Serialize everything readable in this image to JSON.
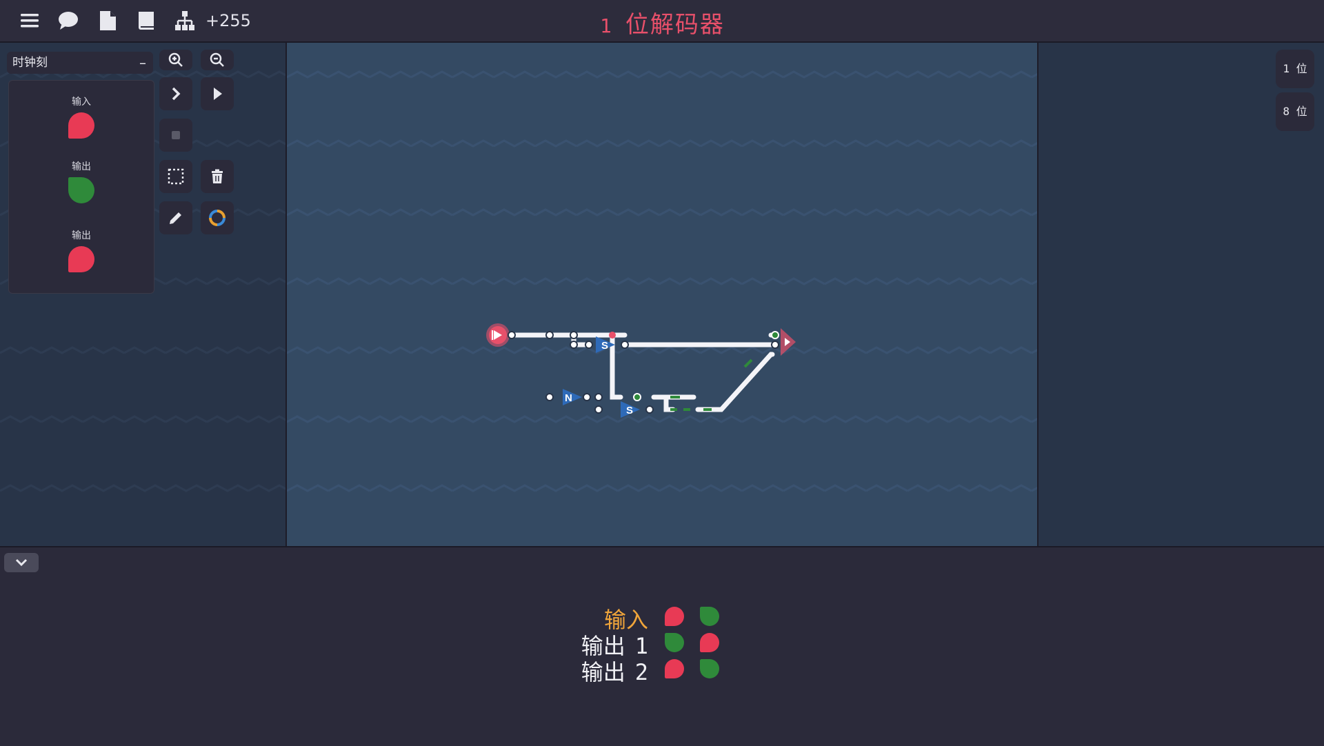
{
  "topbar": {
    "counter": "+255",
    "title_num": "1",
    "title_text": "位解码器",
    "title_color": "#e8506a",
    "icons": [
      "menu-icon",
      "chat-icon",
      "file-icon",
      "book-icon",
      "hierarchy-icon"
    ]
  },
  "sidebar": {
    "dropdown_value": "时钟刻",
    "dropdown_minus": "–",
    "palette": [
      {
        "label": "输入",
        "color": "red"
      },
      {
        "label": "输出",
        "color": "green"
      },
      {
        "label": "输出",
        "color": "red"
      }
    ]
  },
  "tools": [
    "zoom-in-icon",
    "zoom-out-icon",
    "step-icon",
    "play-icon",
    "stop-icon",
    "select-icon",
    "trash-icon",
    "pencil-icon",
    "color-ring-icon"
  ],
  "bit_buttons": [
    "1 位",
    "8 位"
  ],
  "circuit": {
    "gate_labels": [
      "S",
      "N",
      "S"
    ]
  },
  "truth_table": {
    "rows": [
      {
        "label": "输入",
        "num": "",
        "color": "#f0a53a",
        "cells": [
          "red",
          "green"
        ]
      },
      {
        "label": "输出",
        "num": "1",
        "color": "#f0f0f4",
        "cells": [
          "green",
          "red"
        ]
      },
      {
        "label": "输出",
        "num": "2",
        "color": "#f0f0f4",
        "cells": [
          "red",
          "green"
        ]
      }
    ]
  },
  "colors": {
    "red": "#e83a55",
    "green": "#2f8a3a",
    "canvas": "#344a63",
    "panel": "#283448",
    "bar": "#2b2a3a"
  }
}
